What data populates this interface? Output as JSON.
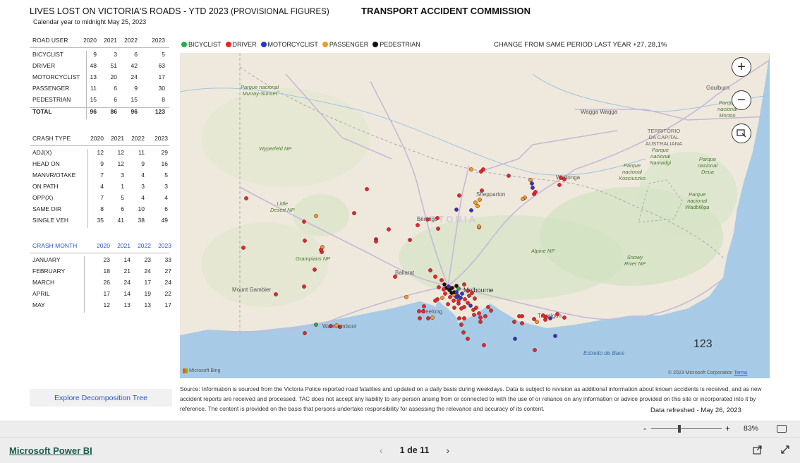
{
  "header": {
    "title": "LIVES LOST ON VICTORIA'S ROADS - YTD 2023",
    "title_suffix": "(PROVISIONAL FIGURES)",
    "subtitle": "Calendar year to midnight May 25, 2023",
    "org": "TRANSPORT ACCIDENT COMMISSION"
  },
  "road_user": {
    "header": [
      "ROAD USER",
      "2020",
      "2021",
      "2022",
      "2023"
    ],
    "rows": [
      [
        "BICYCLIST",
        "9",
        "3",
        "6",
        "5"
      ],
      [
        "DRIVER",
        "48",
        "51",
        "42",
        "63"
      ],
      [
        "MOTORCYCLIST",
        "13",
        "20",
        "24",
        "17"
      ],
      [
        "PASSENGER",
        "11",
        "6",
        "9",
        "30"
      ],
      [
        "PEDESTRIAN",
        "15",
        "6",
        "15",
        "8"
      ]
    ],
    "total": [
      "TOTAL",
      "96",
      "86",
      "96",
      "123"
    ]
  },
  "crash_type": {
    "header": [
      "CRASH TYPE",
      "2020",
      "2021",
      "2022",
      "2023"
    ],
    "rows": [
      [
        "ADJ(X)",
        "12",
        "12",
        "11",
        "29"
      ],
      [
        "HEAD ON",
        "9",
        "12",
        "9",
        "16"
      ],
      [
        "MANVR/OTAKE",
        "7",
        "3",
        "4",
        "5"
      ],
      [
        "ON PATH",
        "4",
        "1",
        "3",
        "3"
      ],
      [
        "OPP(X)",
        "7",
        "5",
        "4",
        "4"
      ],
      [
        "SAME DIR",
        "8",
        "6",
        "10",
        "6"
      ],
      [
        "SINGLE VEH",
        "35",
        "41",
        "38",
        "49"
      ]
    ]
  },
  "crash_month": {
    "header": [
      "CRASH MONTH",
      "2020",
      "2021",
      "2022",
      "2023"
    ],
    "rows": [
      [
        "JANUARY",
        "23",
        "14",
        "23",
        "33"
      ],
      [
        "FEBRUARY",
        "18",
        "21",
        "24",
        "27"
      ],
      [
        "MARCH",
        "26",
        "24",
        "17",
        "24"
      ],
      [
        "APRIL",
        "17",
        "14",
        "19",
        "22"
      ],
      [
        "MAY",
        "12",
        "13",
        "13",
        "17"
      ]
    ]
  },
  "legend": [
    {
      "label": "BICYCLIST",
      "color": "#22b14c"
    },
    {
      "label": "DRIVER",
      "color": "#e8262a"
    },
    {
      "label": "MOTORCYCLIST",
      "color": "#2436d9"
    },
    {
      "label": "PASSENGER",
      "color": "#f39c1f"
    },
    {
      "label": "PEDESTRIAN",
      "color": "#111111"
    }
  ],
  "change_text": "CHANGE FROM SAME PERIOD LAST YEAR +27,   28,1%",
  "map": {
    "total_label": "123",
    "places": [
      "Parque nacional Murray-Sunset",
      "Wyperfeld NP",
      "Little Desert NP",
      "Grampians NP",
      "Bendigo",
      "Shepparton",
      "Wodonga",
      "Wagga Wagga",
      "Goulburn",
      "Ballarat",
      "Melbourne",
      "Geelong",
      "Warrnambool",
      "Mount Gambier",
      "Traralgon",
      "VICTORIA",
      "Alpine NP",
      "Snowy River NP",
      "Estreito de Bass",
      "TERRITÓRIO DA CAPITAL AUSTRALIANA",
      "Parque nacional Namadgi",
      "Parque nacional Kosciuszko",
      "Parque nacional Deua",
      "Parque nacional Wadbilliga",
      "Parque nacional Morton"
    ],
    "attribution_left": "Microsoft Bing",
    "attribution_right": "© 2023 Microsoft Corporation",
    "terms": "Terms",
    "zoom_in_icon": "plus-icon",
    "zoom_out_icon": "minus-icon",
    "select_icon": "lasso-select-icon"
  },
  "decomp_button": "Explore Decomposition Tree",
  "source_text": "Source: Information is sourced from the Victoria Police reported road fatalities and updated on a daily basis during weekdays. Data is subject to revision as additional information about known accidents is received, and as new accident reports are received and processed. TAC does not accept any liability to any person arising from or connected to with the use of or reliance on any information or advice provided on this site or incorporated into it by reference. The content is provided on the basis that persons undertake responsibility for assessing the relevance and accuracy of its content.",
  "refreshed": "Data refreshed - May 26, 2023",
  "zoom": {
    "minus": "-",
    "plus": "+",
    "level": "83%",
    "fit_icon": "fit-to-page-icon"
  },
  "footer": {
    "brand": "Microsoft Power BI",
    "page": "1 de 11",
    "prev_icon": "chevron-left-icon",
    "next_icon": "chevron-right-icon",
    "share_icon": "share-icon",
    "fullscreen_icon": "fullscreen-icon"
  }
}
